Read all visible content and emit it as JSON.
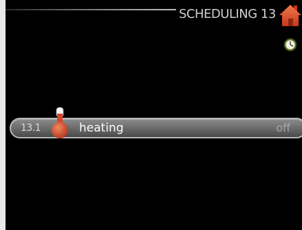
{
  "header": {
    "title": "SCHEDULING 13",
    "home_icon": "home-icon",
    "clock_icon": "clock-icon"
  },
  "menu": {
    "items": [
      {
        "number": "13.1",
        "icon": "thermometer-icon",
        "label": "heating",
        "value": "off"
      }
    ]
  },
  "colors": {
    "background": "#000000",
    "accent_red": "#d5452a",
    "clock_green": "#5f7a2e",
    "text_light": "#cfcfcf"
  }
}
